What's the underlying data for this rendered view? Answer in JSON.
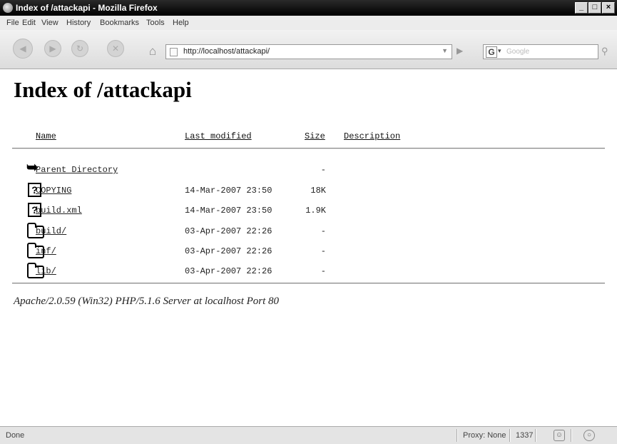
{
  "window": {
    "title": "Index of /attackapi - Mozilla Firefox"
  },
  "menu": [
    "File",
    "Edit",
    "View",
    "History",
    "Bookmarks",
    "Tools",
    "Help"
  ],
  "navbar": {
    "url": "http://localhost/attackapi/",
    "search_placeholder": "Google",
    "search_engine_letter": "G"
  },
  "page": {
    "heading": "Index of /attackapi",
    "columns": {
      "name": "Name",
      "modified": "Last modified",
      "size": "Size",
      "description": "Description"
    },
    "entries": [
      {
        "icon": "back-arrow-icon",
        "name": "Parent Directory",
        "modified": "",
        "size": "-"
      },
      {
        "icon": "unknown-file-icon",
        "name": "COPYING",
        "modified": "14-Mar-2007 23:50",
        "size": "18K"
      },
      {
        "icon": "unknown-file-icon",
        "name": "build.xml",
        "modified": "14-Mar-2007 23:50",
        "size": "1.9K"
      },
      {
        "icon": "folder-icon",
        "name": "build/",
        "modified": "03-Apr-2007 22:26",
        "size": "-"
      },
      {
        "icon": "folder-icon",
        "name": "inf/",
        "modified": "03-Apr-2007 22:26",
        "size": "-"
      },
      {
        "icon": "folder-icon",
        "name": "lib/",
        "modified": "03-Apr-2007 22:26",
        "size": "-"
      }
    ],
    "footer": "Apache/2.0.59 (Win32) PHP/5.1.6 Server at localhost Port 80"
  },
  "status": {
    "text": "Done",
    "proxy": "Proxy: None",
    "counter": "1337"
  }
}
